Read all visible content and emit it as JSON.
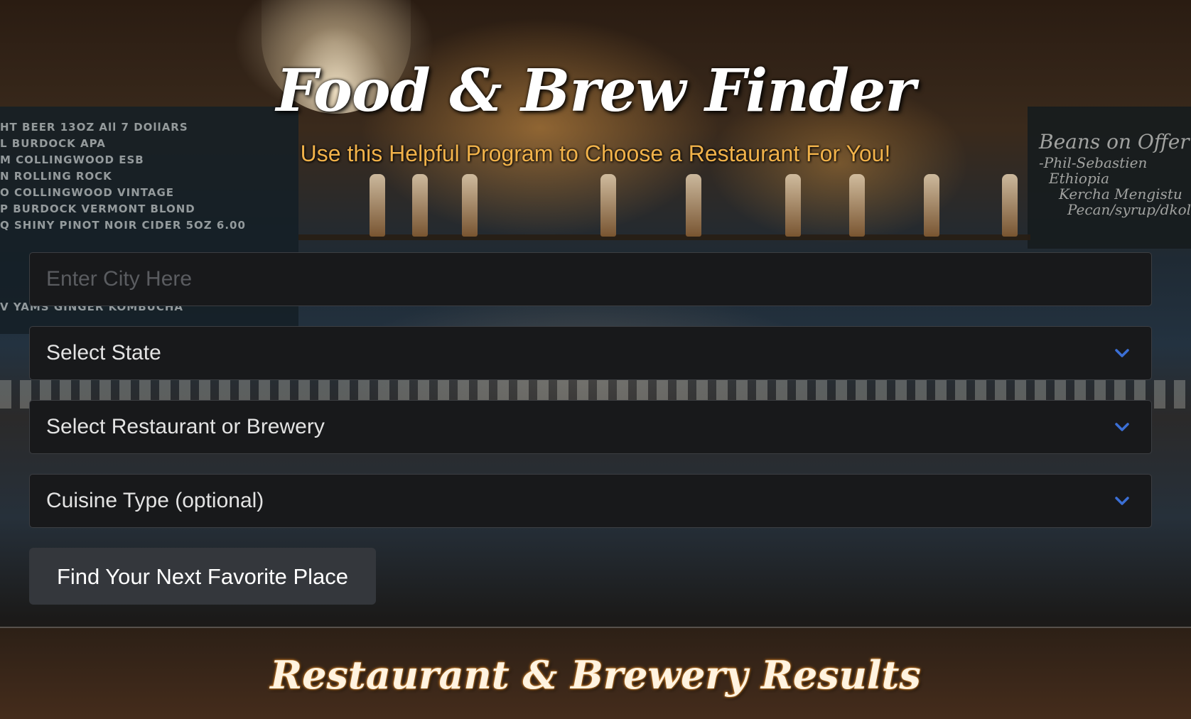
{
  "header": {
    "title": "Food & Brew Finder",
    "subtitle": "Use this Helpful Program to Choose a Restaurant For You!"
  },
  "background": {
    "chalkboard_left": [
      "HT   BEER          13OZ   All 7 DOllARS",
      "L  BURDOCK   APA",
      "M COLLINGWOOD  ESB",
      "N  ROLLING ROCK",
      "O COLLINGWOOD  VINTAGE",
      "P  BURDOCK  VERMONT  BLOND",
      "Q  SHINY PINOT NOIR CIDER   5OZ     6.00"
    ],
    "chalkboard_left_bottom": "V  YAMS  GINGER  KOMBUCHA",
    "chalkboard_right": [
      "Beans on Offer",
      "-Phil-Sebastien",
      "Ethiopia",
      "Kercha Mengistu",
      "Pecan/syrup/dkolT"
    ]
  },
  "form": {
    "city_placeholder": "Enter City Here",
    "city_value": "",
    "state_select": "Select State",
    "type_select": "Select Restaurant or Brewery",
    "cuisine_select": "Cuisine Type (optional)",
    "submit_label": "Find Your Next Favorite Place"
  },
  "results": {
    "title": "Restaurant & Brewery Results"
  },
  "colors": {
    "accent": "#f1b24a",
    "chevron": "#3b6fd6",
    "field_bg": "#18191b",
    "button_bg": "#34373c"
  }
}
